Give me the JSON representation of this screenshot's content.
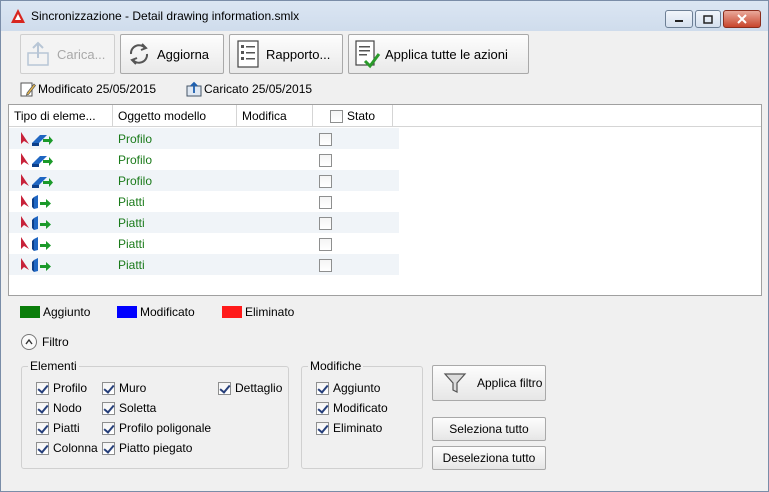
{
  "window": {
    "title": "Sincronizzazione - Detail drawing information.smlx",
    "icon": "autocad-a-icon",
    "controls": [
      "minimize",
      "maximize",
      "close"
    ]
  },
  "toolbar": {
    "carica_label": "Carica...",
    "aggiorna_label": "Aggiorna",
    "rapporto_label": "Rapporto...",
    "applica_label": "Applica tutte le azioni"
  },
  "info": {
    "modificato": "Modificato 25/05/2015",
    "caricato": "Caricato 25/05/2015"
  },
  "table": {
    "headers": {
      "tipo": "Tipo di eleme...",
      "oggetto": "Oggetto modello",
      "modifica": "Modifica",
      "stato": "Stato"
    },
    "rows": [
      {
        "oggetto": "Profilo",
        "icon": "profile-element-icon",
        "checked": false
      },
      {
        "oggetto": "Profilo",
        "icon": "profile-element-icon",
        "checked": false
      },
      {
        "oggetto": "Profilo",
        "icon": "profile-element-icon",
        "checked": false
      },
      {
        "oggetto": "Piatti",
        "icon": "plate-element-icon",
        "checked": false
      },
      {
        "oggetto": "Piatti",
        "icon": "plate-element-icon",
        "checked": false
      },
      {
        "oggetto": "Piatti",
        "icon": "plate-element-icon",
        "checked": false
      },
      {
        "oggetto": "Piatti",
        "icon": "plate-element-icon",
        "checked": false
      }
    ]
  },
  "legend": {
    "aggiunto": "Aggiunto",
    "modificato": "Modificato",
    "eliminato": "Eliminato",
    "colors": {
      "aggiunto": "#0a7d0a",
      "modificato": "#0000ff",
      "eliminato": "#ff1a1a"
    }
  },
  "filtro": {
    "label": "Filtro",
    "elementi_title": "Elementi",
    "elementi": {
      "profilo": "Profilo",
      "nodo": "Nodo",
      "piatti": "Piatti",
      "colonna": "Colonna",
      "muro": "Muro",
      "soletta": "Soletta",
      "profilo_poligonale": "Profilo poligonale",
      "piatto_piegato": "Piatto piegato",
      "dettaglio": "Dettaglio"
    },
    "modifiche_title": "Modifiche",
    "modifiche": {
      "aggiunto": "Aggiunto",
      "modificato": "Modificato",
      "eliminato": "Eliminato"
    },
    "applica_filtro": "Applica filtro",
    "seleziona_tutto": "Seleziona tutto",
    "deseleziona_tutto": "Deseleziona tutto"
  },
  "colors": {
    "object_text": "#1a7a1a",
    "row_alt": "#f0f4f8"
  }
}
